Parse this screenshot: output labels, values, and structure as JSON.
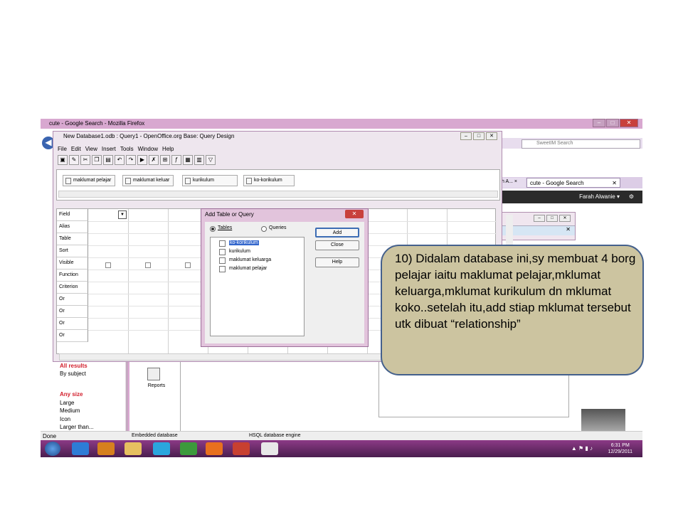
{
  "firefox": {
    "title": "cute - Google Search - Mozilla Firefox",
    "search_placeholder": "SweetIM Search",
    "tab_partial": "h A... ×",
    "tab_active": "cute - Google Search",
    "user": "Farah Alwanie ▾",
    "status": "Done",
    "sidebar": {
      "all_results": "All results",
      "by_subject": "By subject",
      "any_size": "Any size",
      "large": "Large",
      "medium": "Medium",
      "icon": "Icon",
      "larger_than": "Larger than..."
    },
    "reports_label": "Reports",
    "embedded": "Embedded database",
    "hsql": "HSQL database engine"
  },
  "ooo": {
    "title": "New Database1.odb : Query1 - OpenOffice.org Base: Query Design",
    "menu": [
      "File",
      "Edit",
      "View",
      "Insert",
      "Tools",
      "Window",
      "Help"
    ],
    "tables": [
      "maklumat pelajar",
      "maklumat keluar",
      "kurikulum",
      "ko-korikulum"
    ],
    "rows": [
      "Field",
      "Alias",
      "Table",
      "Sort",
      "Visible",
      "Function",
      "Criterion",
      "Or",
      "Or",
      "Or",
      "Or"
    ]
  },
  "dialog": {
    "title": "Add Table or Query",
    "radio_tables": "Tables",
    "radio_queries": "Queries",
    "items": [
      "ko-korikulum",
      "kurikulum",
      "maklumat keluarga",
      "maklumat pelajar"
    ],
    "buttons": {
      "add": "Add",
      "close": "Close",
      "help": "Help"
    }
  },
  "taskbar": {
    "time": "6:31 PM",
    "date": "12/29/2011"
  },
  "callout": {
    "text": "10) Didalam database ini,sy membuat 4 borg pelajar iaitu maklumat pelajar,mklumat keluarga,mklumat kurikulum dn mklumat koko..setelah itu,add stiap mklumat tersebut utk dibuat “relationship”"
  }
}
